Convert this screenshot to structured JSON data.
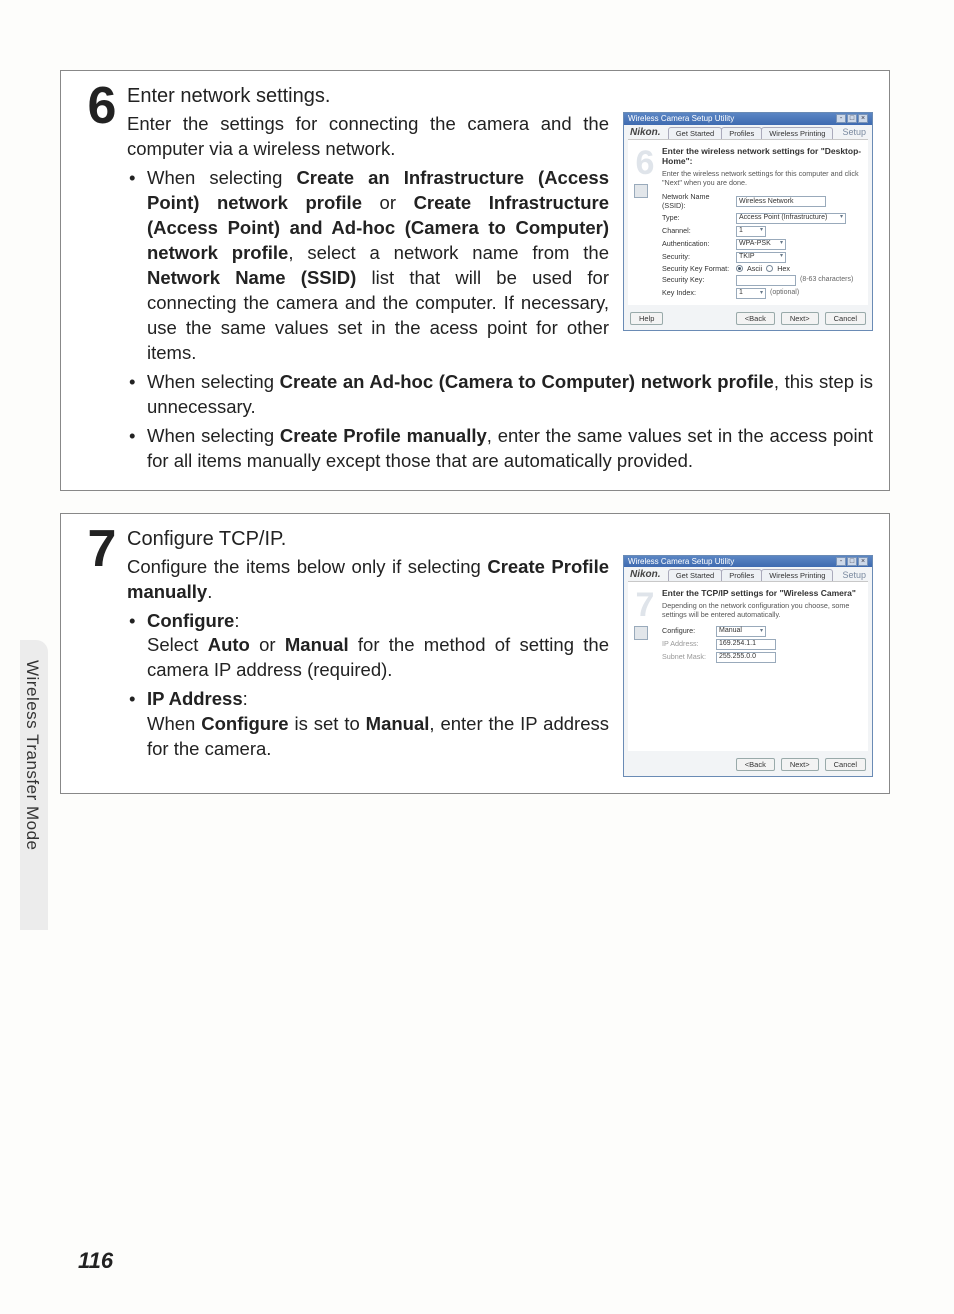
{
  "side_label": "Wireless Transfer Mode",
  "page_number": "116",
  "step6": {
    "num": "6",
    "title": "Enter network settings.",
    "intro": "Enter the settings for connecting the camera and the computer via a wireless network.",
    "bullet1_pre": "When selecting ",
    "bullet1_b1": "Create an Infrastructure (Access Point) network profile",
    "bullet1_mid1": " or ",
    "bullet1_b2": "Create Infrastructure (Access Point) and Ad-hoc (Camera to Computer) network profile",
    "bullet1_mid2": ", select a network name from the ",
    "bullet1_b3": "Network Name (SSID)",
    "bullet1_post": " list that will be used for connecting the camera and the computer. If necessary, use the same values set in the acess point for other items.",
    "bullet2_pre": "When selecting ",
    "bullet2_b1": "Create an Ad-hoc (Camera to Computer) network profile",
    "bullet2_post": ", this step is unnecessary.",
    "bullet3_pre": "When selecting ",
    "bullet3_b1": "Create Profile manually",
    "bullet3_post": ", enter the same values set in the access point for all items manually except those that are automatically provided."
  },
  "step7": {
    "num": "7",
    "title": "Configure TCP/IP.",
    "intro_pre": "Configure the items below only if selecting ",
    "intro_b": "Create Profile manually",
    "intro_post": ".",
    "b1_label": "Configure",
    "b1_pre": "Select ",
    "b1_b1": "Auto",
    "b1_mid": " or ",
    "b1_b2": "Manual",
    "b1_post": " for the method of setting the camera IP address (required).",
    "b2_label": "IP Address",
    "b2_pre": "When ",
    "b2_b1": "Configure",
    "b2_mid": " is set to ",
    "b2_b2": "Manual",
    "b2_post": ", enter the IP address for the camera."
  },
  "shot": {
    "title": "Wireless Camera Setup Utility",
    "brand": "Nikon.",
    "tabs": {
      "t1": "Get Started",
      "t2": "Profiles",
      "t3": "Wireless Printing"
    },
    "setup": "Setup",
    "btn_help": "Help",
    "btn_back": "<Back",
    "btn_next": "Next>",
    "btn_cancel": "Cancel"
  },
  "shot6": {
    "stepnum": "6",
    "heading": "Enter the wireless network settings for \"Desktop-Home\":",
    "sub": "Enter the wireless network settings for this computer and click \"Next\" when you are done.",
    "l_ssid": "Network Name (SSID):",
    "v_ssid": "Wireless Network",
    "l_type": "Type:",
    "v_type": "Access Point (Infrastructure)",
    "l_channel": "Channel:",
    "v_channel": "1",
    "l_auth": "Authentication:",
    "v_auth": "WPA-PSK",
    "l_sec": "Security:",
    "v_sec": "TKIP",
    "l_fmt": "Security Key Format:",
    "r_ascii": "Ascii",
    "r_hex": "Hex",
    "l_key": "Security Key:",
    "n_key": "(8-63 characters)",
    "l_idx": "Key Index:",
    "v_idx": "1",
    "n_idx": "(optional)"
  },
  "shot7": {
    "stepnum": "7",
    "heading": "Enter the TCP/IP settings for \"Wireless Camera\"",
    "sub": "Depending on the network configuration you choose, some settings will be entered automatically.",
    "l_conf": "Configure:",
    "v_conf": "Manual",
    "l_ip": "IP Address:",
    "v_ip": "169.254.1.1",
    "l_mask": "Subnet Mask:",
    "v_mask": "255.255.0.0"
  }
}
